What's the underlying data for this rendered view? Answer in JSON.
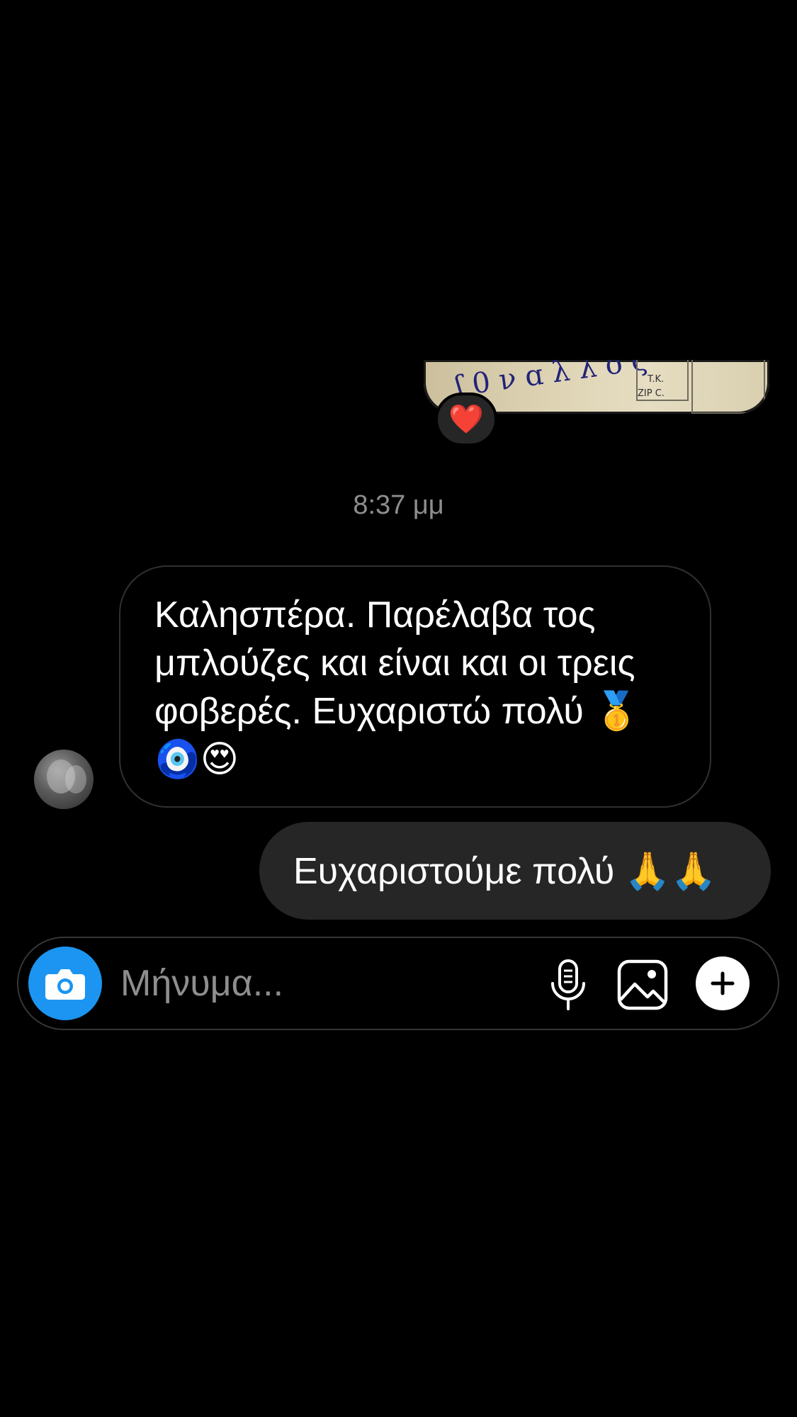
{
  "thread": {
    "shared_photo": {
      "reaction": "❤️",
      "visible_print": [
        "T.K.",
        "ZIP C."
      ]
    },
    "timestamp": "8:37 μμ",
    "incoming_message": {
      "text": "Καλησπέρα. Παρέλαβα τος\nμπλούζες και είναι και οι τρεις\nφοβερές. Ευχαριστώ πολύ 🥇\n🧿😍"
    },
    "outgoing_message": {
      "text": "Ευχαριστούμε πολύ 🙏🙏"
    }
  },
  "composer": {
    "placeholder": "Μήνυμα...",
    "camera_icon": "camera-icon",
    "mic_icon": "microphone-icon",
    "gallery_icon": "image-gallery-icon",
    "plus_icon": "plus-icon"
  },
  "colors": {
    "background": "#000000",
    "outgoing_bubble": "#262626",
    "incoming_bubble_border": "#303030",
    "camera_button": "#1b95f1",
    "secondary_text": "#8e8e8e"
  }
}
